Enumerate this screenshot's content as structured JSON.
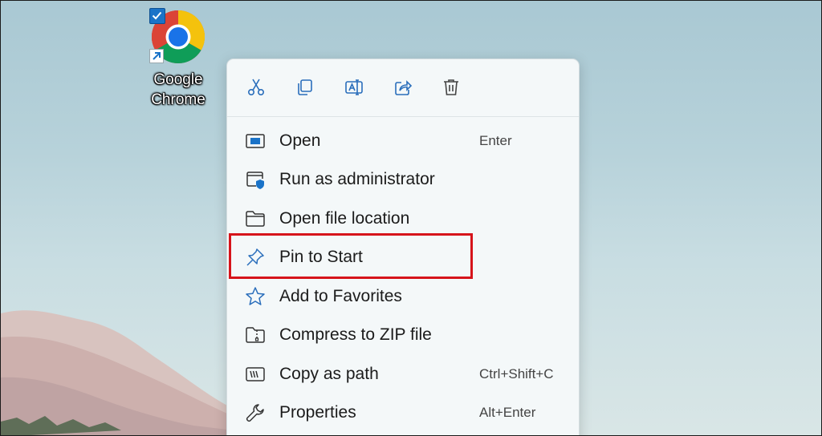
{
  "desktop": {
    "icon_label": "Google\nChrome",
    "icon_name": "chrome-icon"
  },
  "quick_actions": [
    {
      "name": "cut",
      "icon": "scissors-icon"
    },
    {
      "name": "copy",
      "icon": "copy-icon"
    },
    {
      "name": "rename",
      "icon": "rename-icon"
    },
    {
      "name": "share",
      "icon": "share-icon"
    },
    {
      "name": "delete",
      "icon": "trash-icon"
    }
  ],
  "menu": {
    "items": [
      {
        "label": "Open",
        "shortcut": "Enter",
        "icon": "window-icon"
      },
      {
        "label": "Run as administrator",
        "shortcut": "",
        "icon": "shield-window-icon"
      },
      {
        "label": "Open file location",
        "shortcut": "",
        "icon": "folder-icon"
      },
      {
        "label": "Pin to Start",
        "shortcut": "",
        "icon": "pin-icon"
      },
      {
        "label": "Add to Favorites",
        "shortcut": "",
        "icon": "star-icon"
      },
      {
        "label": "Compress to ZIP file",
        "shortcut": "",
        "icon": "zip-folder-icon"
      },
      {
        "label": "Copy as path",
        "shortcut": "Ctrl+Shift+C",
        "icon": "path-icon"
      },
      {
        "label": "Properties",
        "shortcut": "Alt+Enter",
        "icon": "wrench-icon"
      }
    ]
  },
  "colors": {
    "accent": "#1a73c8",
    "highlight": "#d6141b",
    "menu_bg": "#f4f8f9"
  }
}
